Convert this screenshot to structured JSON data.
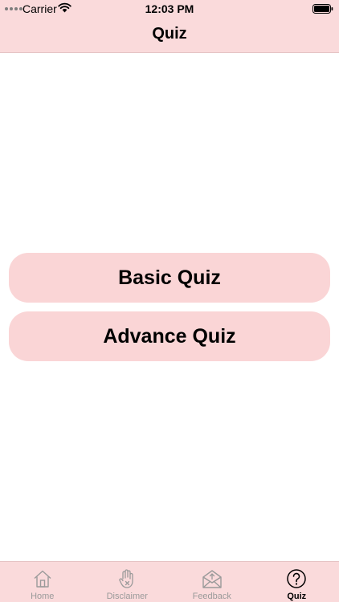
{
  "status_bar": {
    "carrier": "Carrier",
    "time": "12:03 PM",
    "wifi_icon": "wifi-icon",
    "battery_icon": "battery-icon"
  },
  "nav": {
    "title": "Quiz"
  },
  "main": {
    "buttons": [
      {
        "label": "Basic Quiz"
      },
      {
        "label": "Advance Quiz"
      }
    ]
  },
  "tabbar": {
    "items": [
      {
        "label": "Home",
        "icon": "home-icon",
        "active": false
      },
      {
        "label": "Disclaimer",
        "icon": "hand-icon",
        "active": false
      },
      {
        "label": "Feedback",
        "icon": "envelope-icon",
        "active": false
      },
      {
        "label": "Quiz",
        "icon": "question-circle-icon",
        "active": true
      }
    ]
  },
  "colors": {
    "bar_background": "#fadadb",
    "button_background": "#fad5d6",
    "inactive_tab": "#9a9a9a",
    "active_tab": "#000000"
  }
}
